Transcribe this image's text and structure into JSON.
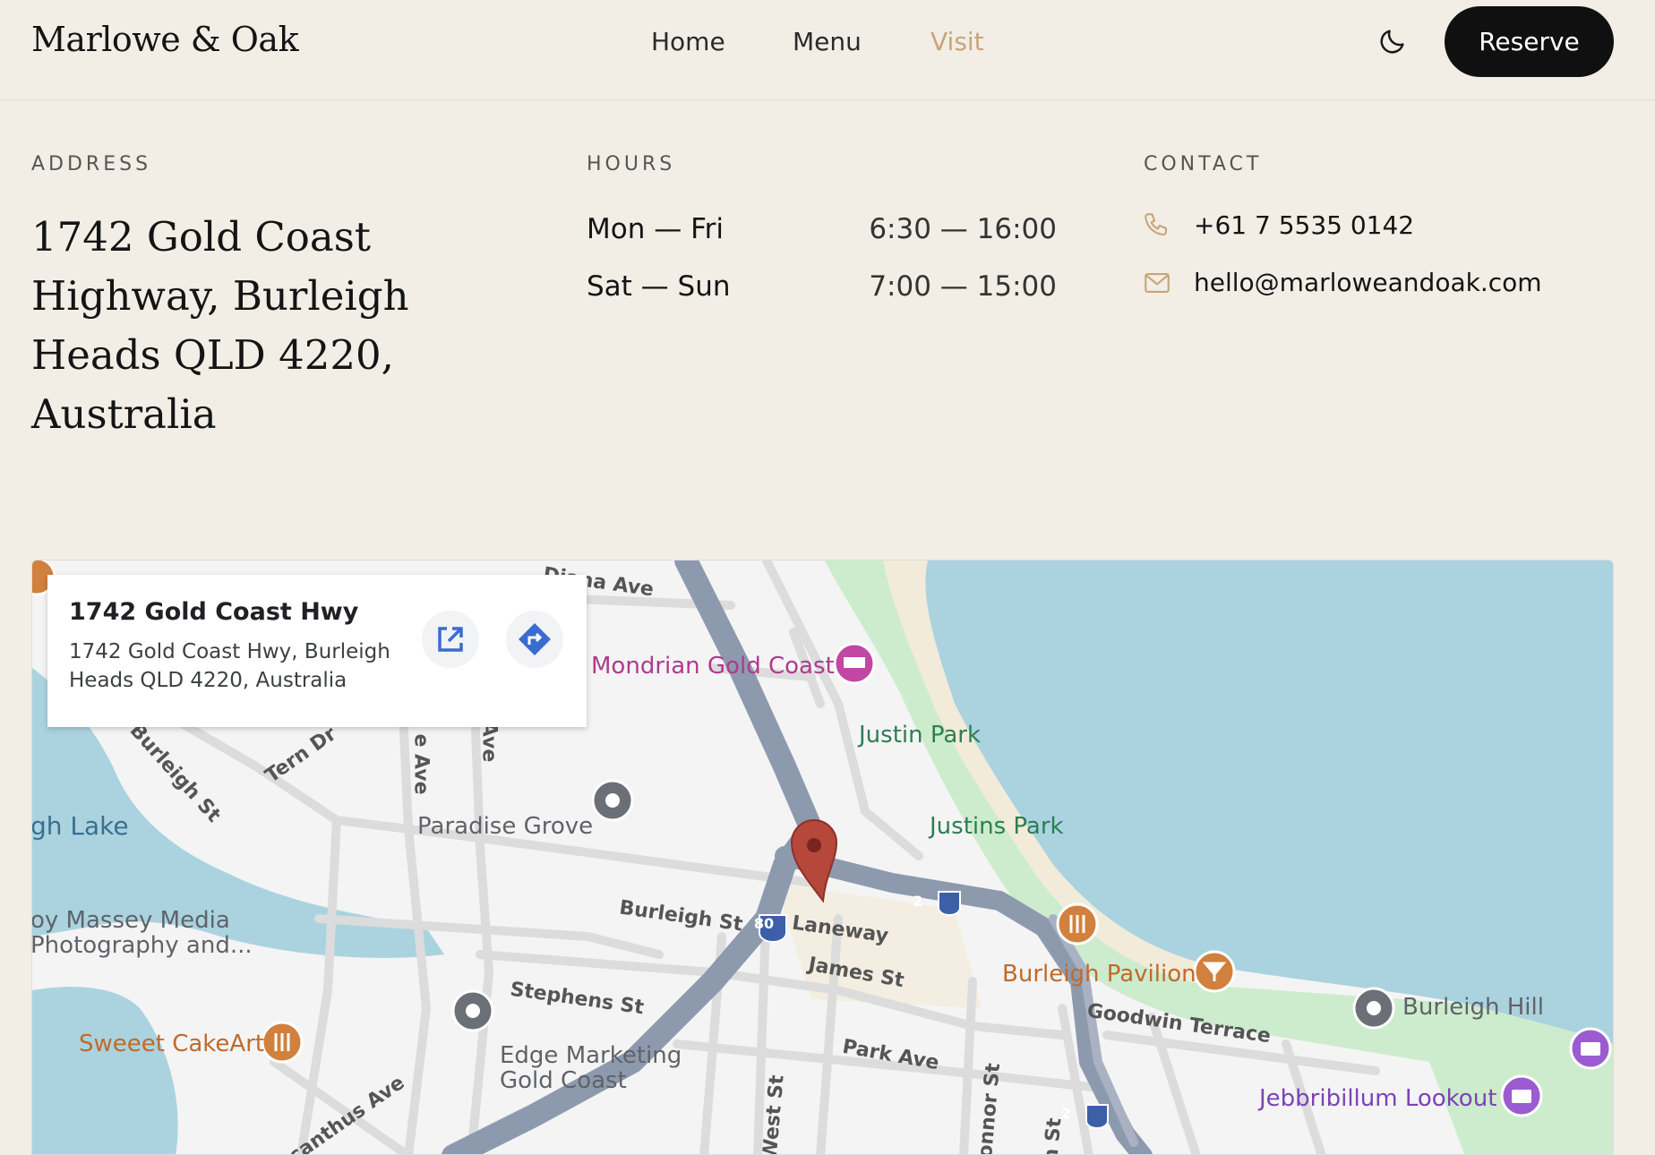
{
  "header": {
    "logo": "Marlowe & Oak",
    "nav": [
      {
        "label": "Home",
        "active": false
      },
      {
        "label": "Menu",
        "active": false
      },
      {
        "label": "Visit",
        "active": true
      }
    ],
    "theme_toggle_icon": "moon-icon",
    "reserve_label": "Reserve"
  },
  "address": {
    "label": "ADDRESS",
    "text": "1742 Gold Coast Highway, Burleigh Heads QLD 4220, Australia"
  },
  "hours": {
    "label": "HOURS",
    "rows": [
      {
        "days": "Mon — Fri",
        "time": "6:30 — 16:00"
      },
      {
        "days": "Sat — Sun",
        "time": "7:00 — 15:00"
      }
    ]
  },
  "contact": {
    "label": "CONTACT",
    "phone": "+61 7 5535 0142",
    "email": "hello@marloweandoak.com",
    "phone_icon": "phone-icon",
    "email_icon": "mail-icon"
  },
  "map": {
    "infocard": {
      "title": "1742 Gold Coast Hwy",
      "subtitle": "1742 Gold Coast Hwy, Burleigh Heads QLD 4220, Australia",
      "open_icon": "open-in-new-icon",
      "directions_icon": "directions-icon"
    },
    "places": {
      "mondrian": "Mondrian Gold Coast",
      "justin_park": "Justin Park",
      "justins_park": "Justins Park",
      "paradise_grove": "Paradise Grove",
      "lake": "gh Lake",
      "massey_1": "oy Massey Media",
      "massey_2": "Photography and...",
      "burleigh_pavilion": "Burleigh Pavilion",
      "burleigh_hill": "Burleigh Hill",
      "jebbribillum": "Jebbribillum Lookout",
      "sweeet": "Sweeet CakeArt",
      "edge_1": "Edge Marketing",
      "edge_2": "Gold Coast"
    },
    "streets": {
      "diana": "Diana Ave",
      "burleigh_st_a": "Burleigh St",
      "burleigh_st_b": "Burleigh St",
      "tern": "Tern Dr",
      "laneway": "Laneway",
      "james": "James St",
      "stephens": "Stephens St",
      "park": "Park Ave",
      "goodwin": "Goodwin Terrace",
      "west": "West St",
      "connor": "Connor St",
      "acanthus": "Acanthus Ave",
      "ave_1": "e Ave",
      "ave_2": "Ave",
      "st_partial": "n St"
    },
    "shields": {
      "a": "80",
      "b": "2",
      "c": "2"
    },
    "colors": {
      "water": "#aad3df",
      "park": "#cdeccd",
      "road_major": "#8d9aae",
      "sand": "#f2ebd9",
      "pin": "#b5473b"
    }
  }
}
